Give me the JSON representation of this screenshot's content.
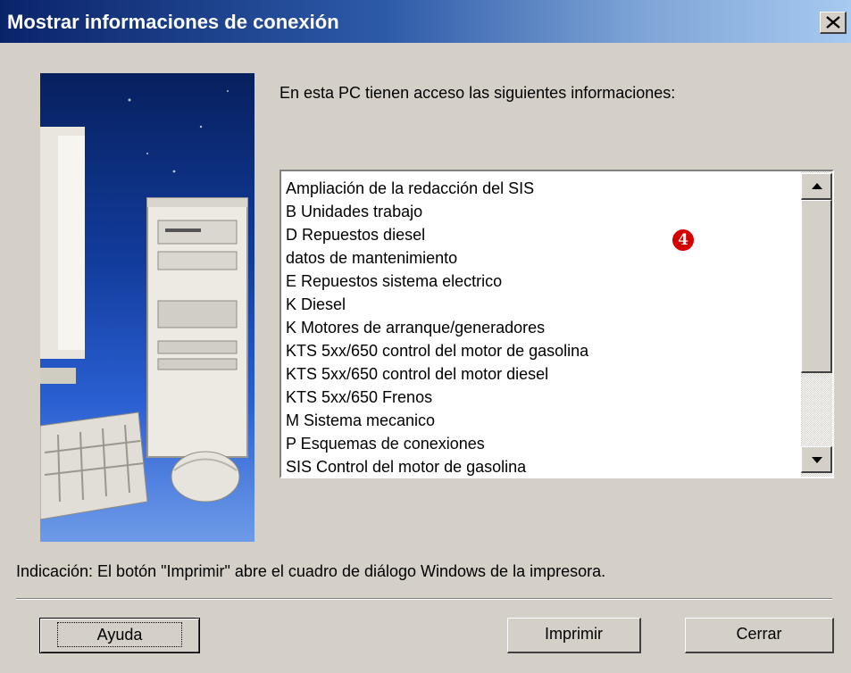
{
  "window": {
    "title": "Mostrar informaciones de conexión",
    "close_glyph": "✕"
  },
  "intro_text": "En esta PC tienen acceso las siguientes informaciones:",
  "list": {
    "items": [
      "Ampliación de la redacción del SIS",
      "B Unidades trabajo",
      "D Repuestos diesel",
      "datos de mantenimiento",
      "E Repuestos sistema electrico",
      "K Diesel",
      "K Motores de arranque/generadores",
      "KTS 5xx/650 control del motor de gasolina",
      "KTS 5xx/650 control del motor diesel",
      "KTS 5xx/650 Frenos",
      "M Sistema mecanico",
      "P Esquemas de conexiones",
      "SIS Control del motor de gasolina"
    ]
  },
  "marker": {
    "label": "4"
  },
  "hint_text": "Indicación: El botón \"Imprimir\" abre el cuadro de diálogo Windows de la impresora.",
  "buttons": {
    "help": "Ayuda",
    "print": "Imprimir",
    "close": "Cerrar"
  },
  "icons": {
    "close": "close-icon",
    "scroll_up": "arrow-up-icon",
    "scroll_down": "arrow-down-icon"
  },
  "colors": {
    "dialog_bg": "#d4d0c8",
    "title_start": "#0a246a",
    "title_end": "#a6caf0",
    "marker": "#d40000"
  }
}
